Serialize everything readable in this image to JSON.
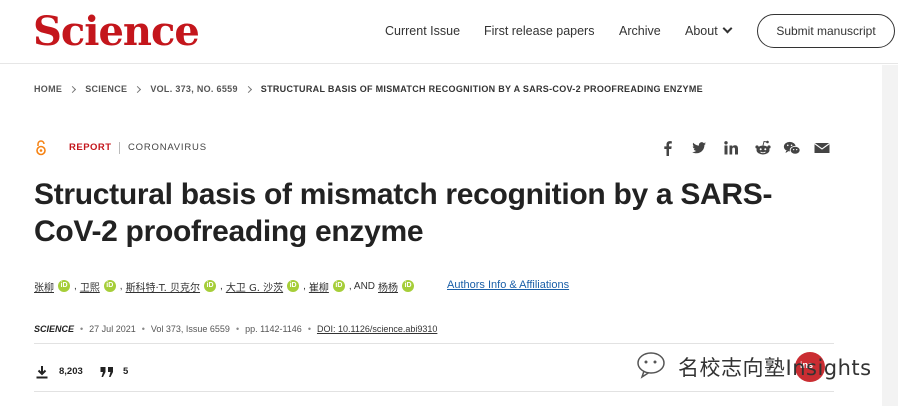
{
  "header": {
    "logo": "Science",
    "nav": {
      "current_issue": "Current Issue",
      "first_release": "First release papers",
      "archive": "Archive",
      "about": "About"
    },
    "submit_label": "Submit manuscript"
  },
  "breadcrumb": {
    "items": [
      "HOME",
      "SCIENCE",
      "VOL. 373, NO. 6559"
    ],
    "current": "STRUCTURAL BASIS OF MISMATCH RECOGNITION BY A SARS-COV-2 PROOFREADING ENZYME"
  },
  "article": {
    "type": "REPORT",
    "topic": "CORONAVIRUS",
    "title": "Structural basis of mismatch recognition by a SARS-CoV-2 proofreading enzyme",
    "authors": [
      "张柳",
      "卫熙",
      "斯科特·T. 贝克尔",
      "大卫 G. 沙茨",
      "崔柳",
      "杨杨"
    ],
    "and_text": ", AND",
    "affiliations_link": "Authors Info & Affiliations",
    "journal": "SCIENCE",
    "date": "27 Jul 2021",
    "volume": "Vol 373, Issue 6559",
    "pages": "pp. 1142-1146",
    "doi": "DOI: 10.1126/science.abi9310"
  },
  "share_icons": [
    "facebook-icon",
    "twitter-icon",
    "linkedin-icon",
    "reddit-icon",
    "wechat-icon",
    "email-icon"
  ],
  "metrics": {
    "downloads": "8,203",
    "citations": "5"
  },
  "watermark": {
    "text": "名校志向塾Insights",
    "badge": "ins"
  },
  "colors": {
    "brand_red": "#c4161c",
    "orcid_green": "#a6ce39",
    "link_blue": "#1a5fa8",
    "oa_orange": "#f68212"
  }
}
